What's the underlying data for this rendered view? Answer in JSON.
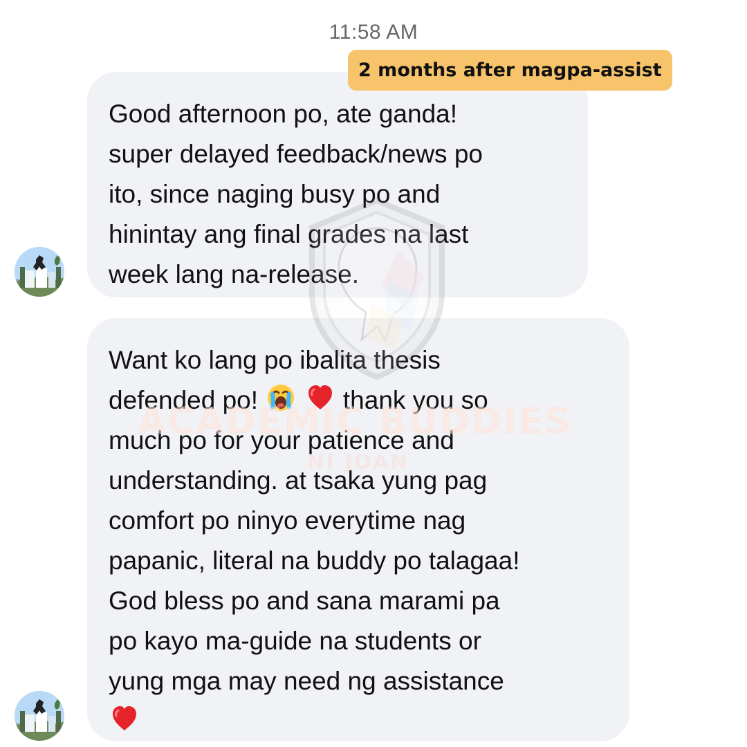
{
  "conversation": {
    "timestamp": "11:58 AM"
  },
  "annotation": {
    "label": "2 months after magpa-assist",
    "background_color": "#f8c46b"
  },
  "messages": [
    {
      "lines": [
        "Good afternoon po, ate ganda!",
        "super delayed feedback/news po",
        "ito, since naging busy po and",
        "hinintay ang final grades na last",
        "week lang na-release."
      ]
    },
    {
      "lines": [
        "Want ko lang po ibalita thesis",
        "defended po!",
        "thank you so",
        "much po for your patience and",
        "understanding. at tsaka yung pag",
        "comfort po ninyo everytime nag",
        "papanic, literal na buddy po talagaa!",
        "God bless po and sana marami pa",
        "po kayo ma-guide na students or",
        "yung mga may need ng assistance"
      ],
      "emojis": [
        "crying-face-emoji",
        "red-heart-emoji",
        "red-heart-emoji"
      ]
    }
  ],
  "colors": {
    "bubble_background": "#f1f2f6",
    "timestamp_text": "#666666"
  }
}
